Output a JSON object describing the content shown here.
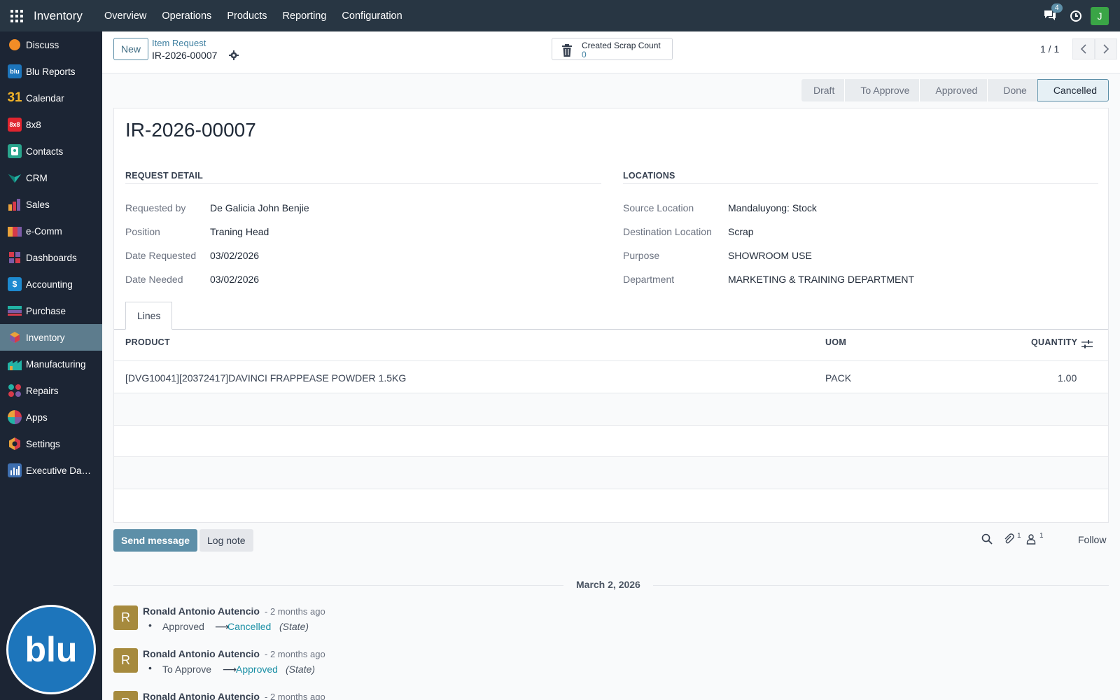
{
  "topbar": {
    "app_name": "Inventory",
    "menu": [
      "Overview",
      "Operations",
      "Products",
      "Reporting",
      "Configuration"
    ],
    "chat_count": "4",
    "user_initial": "J",
    "user_color": "#3aa546"
  },
  "sidebar": {
    "items": [
      {
        "label": "Discuss",
        "icon": "discuss-icon"
      },
      {
        "label": "Blu Reports",
        "icon": "blu-reports-icon"
      },
      {
        "label": "Calendar",
        "icon": "calendar-icon"
      },
      {
        "label": "8x8",
        "icon": "8x8-icon"
      },
      {
        "label": "Contacts",
        "icon": "contacts-icon"
      },
      {
        "label": "CRM",
        "icon": "crm-icon"
      },
      {
        "label": "Sales",
        "icon": "sales-icon"
      },
      {
        "label": "e-Comm",
        "icon": "ecomm-icon"
      },
      {
        "label": "Dashboards",
        "icon": "dashboards-icon"
      },
      {
        "label": "Accounting",
        "icon": "accounting-icon"
      },
      {
        "label": "Purchase",
        "icon": "purchase-icon"
      },
      {
        "label": "Inventory",
        "icon": "inventory-icon",
        "active": true
      },
      {
        "label": "Manufacturing",
        "icon": "manufacturing-icon"
      },
      {
        "label": "Repairs",
        "icon": "repairs-icon"
      },
      {
        "label": "Apps",
        "icon": "apps-icon"
      },
      {
        "label": "Settings",
        "icon": "settings-icon"
      },
      {
        "label": "Executive Das...",
        "icon": "executive-dashboard-icon"
      }
    ],
    "logo_text": "blu"
  },
  "control": {
    "new_label": "New",
    "breadcrumb_parent": "Item Request",
    "breadcrumb_current": "IR-2026-00007",
    "smart_button_label": "Created Scrap Count",
    "smart_button_value": "0",
    "pager": "1 / 1"
  },
  "statusbar": {
    "stages": [
      "Draft",
      "To Approve",
      "Approved",
      "Done",
      "Cancelled"
    ],
    "current": "Cancelled"
  },
  "form": {
    "title": "IR-2026-00007",
    "request_detail": {
      "heading": "REQUEST DETAIL",
      "fields": [
        {
          "label": "Requested by",
          "value": "De Galicia John Benjie"
        },
        {
          "label": "Position",
          "value": "Traning Head"
        },
        {
          "label": "Date Requested",
          "value": "03/02/2026"
        },
        {
          "label": "Date Needed",
          "value": "03/02/2026"
        }
      ]
    },
    "locations": {
      "heading": "LOCATIONS",
      "fields": [
        {
          "label": "Source Location",
          "value": "Mandaluyong: Stock"
        },
        {
          "label": "Destination Location",
          "value": "Scrap"
        },
        {
          "label": "Purpose",
          "value": "SHOWROOM USE"
        },
        {
          "label": "Department",
          "value": "MARKETING & TRAINING DEPARTMENT"
        }
      ]
    },
    "tab_label": "Lines",
    "lines": {
      "headers": [
        "PRODUCT",
        "UOM",
        "QUANTITY"
      ],
      "rows": [
        {
          "product": "[DVG10041][20372417]DAVINCI FRAPPEASE POWDER 1.5KG",
          "uom": "PACK",
          "quantity": "1.00"
        }
      ]
    }
  },
  "chatter": {
    "send_label": "Send message",
    "log_label": "Log note",
    "attachments_count": "1",
    "followers_count": "1",
    "follow_label": "Follow",
    "date_label": "March 2, 2026",
    "messages": [
      {
        "avatar": "R",
        "author": "Ronald Antonio Autencio",
        "date": "- 2 months ago",
        "old": "Approved",
        "new": "Cancelled",
        "field": "(State)"
      },
      {
        "avatar": "R",
        "author": "Ronald Antonio Autencio",
        "date": "- 2 months ago",
        "old": "To Approve",
        "new": "Approved",
        "field": "(State)"
      },
      {
        "avatar": "R",
        "author": "Ronald Antonio Autencio",
        "date": "- 2 months ago"
      }
    ]
  }
}
